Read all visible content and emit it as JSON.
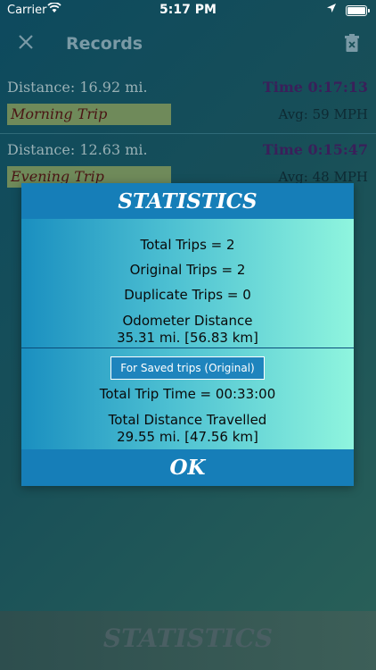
{
  "status_bar": {
    "carrier": "Carrier",
    "time": "5:17 PM"
  },
  "navbar": {
    "title": "Records"
  },
  "records": [
    {
      "distance": "Distance: 16.92 mi.",
      "time": "Time 0:17:13",
      "name": "Morning Trip",
      "avg": "Avg: 59 MPH"
    },
    {
      "distance": "Distance: 12.63 mi.",
      "time": "Time 0:15:47",
      "name": "Evening Trip",
      "avg": "Avg: 48 MPH"
    }
  ],
  "modal": {
    "title": "STATISTICS",
    "total_trips": "Total Trips = 2",
    "original_trips": "Original Trips = 2",
    "duplicate_trips": "Duplicate Trips = 0",
    "odometer_label": "Odometer Distance",
    "odometer_value": "35.31 mi. [56.83 km]",
    "saved_label": "For Saved trips (Original)",
    "total_trip_time": "Total Trip Time = 00:33:00",
    "total_distance_label": "Total Distance Travelled",
    "total_distance_value": "29.55 mi. [47.56 km]",
    "ok_label": "OK"
  },
  "bottom_bar": {
    "label": "STATISTICS"
  }
}
